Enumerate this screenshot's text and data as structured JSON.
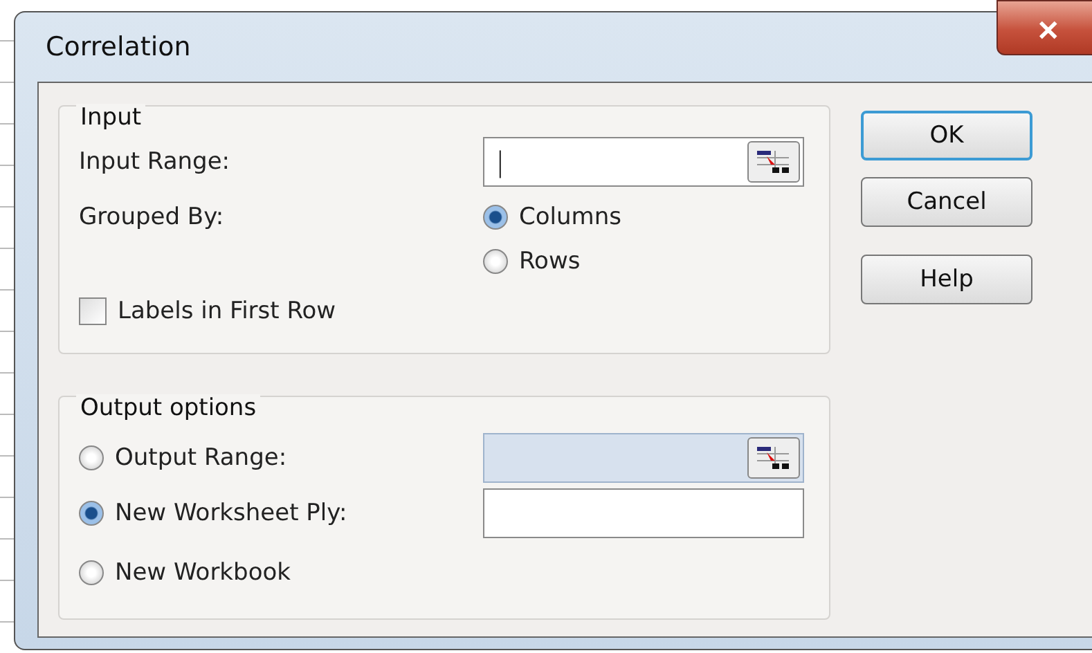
{
  "window": {
    "title": "Correlation",
    "close": "✕"
  },
  "input": {
    "title": "Input",
    "range_label": "Input Range:",
    "range_value": "|",
    "grouped_label": "Grouped By:",
    "grouped_options": [
      {
        "label": "Columns",
        "selected": true
      },
      {
        "label": "Rows",
        "selected": false
      }
    ],
    "labels_first_row": {
      "label": "Labels in First Row",
      "checked": false
    }
  },
  "output": {
    "title": "Output options",
    "options": [
      {
        "label": "Output Range:",
        "selected": false,
        "kind": "range"
      },
      {
        "label": "New Worksheet Ply:",
        "selected": true,
        "kind": "text"
      },
      {
        "label": "New Workbook",
        "selected": false,
        "kind": "none"
      }
    ]
  },
  "buttons": [
    {
      "label": "OK",
      "default": true
    },
    {
      "label": "Cancel",
      "default": false
    },
    {
      "label": "Help",
      "default": false
    }
  ]
}
